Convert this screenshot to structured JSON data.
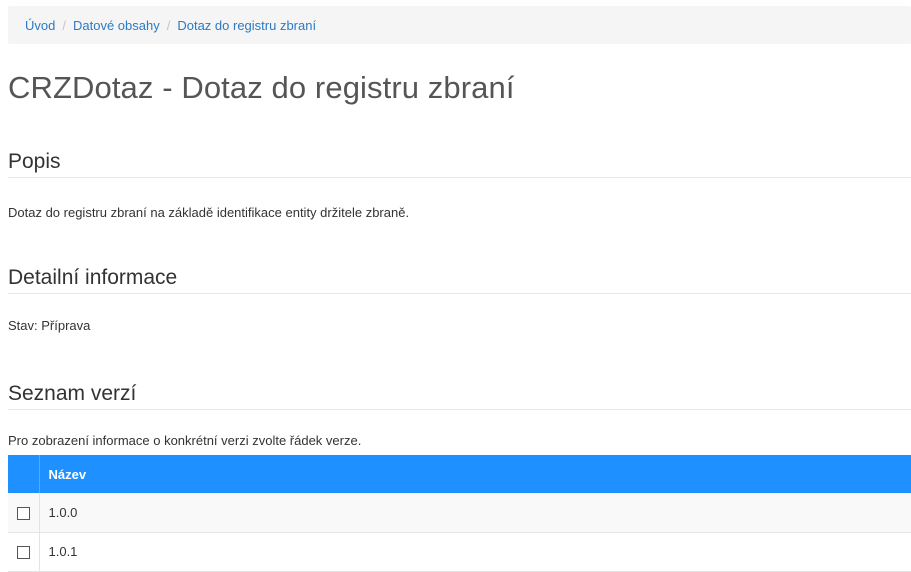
{
  "breadcrumb": {
    "items": [
      "Úvod",
      "Datové obsahy",
      "Dotaz do registru zbraní"
    ],
    "separator": "/"
  },
  "page": {
    "title": "CRZDotaz - Dotaz do registru zbraní"
  },
  "popis": {
    "heading": "Popis",
    "text": "Dotaz do registru zbraní na základě identifikace entity držitele zbraně."
  },
  "detail": {
    "heading": "Detailní informace",
    "stav": "Stav: Příprava"
  },
  "versions": {
    "heading": "Seznam verzí",
    "hint": "Pro zobrazení informace o konkrétní verzi zvolte řádek verze.",
    "column_header": "Název",
    "rows": [
      {
        "name": "1.0.0",
        "checked": false
      },
      {
        "name": "1.0.1",
        "checked": false
      }
    ]
  },
  "colors": {
    "link": "#2a7ac7",
    "table_header": "#1e90ff"
  }
}
